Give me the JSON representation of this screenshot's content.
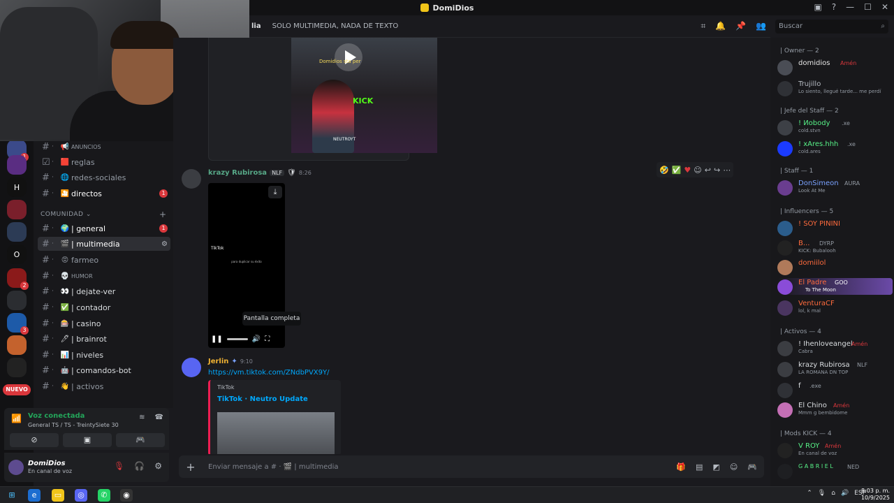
{
  "window": {
    "title": "DomiDios"
  },
  "header": {
    "channel_name": "lia",
    "topic": "SOLO MULTIMEDIA, NADA DE TEXTO",
    "search_placeholder": "Buscar"
  },
  "rail": {
    "badge_1": "1",
    "badge_2": "2",
    "badge_3": "3",
    "badge_4": "3",
    "letter_h": "H",
    "letter_o": "O",
    "new_label": "NUEVO"
  },
  "channels": {
    "category": "COMUNIDAD",
    "items": [
      {
        "emoji": "📢",
        "name": "ANUNCIOS",
        "badge": ""
      },
      {
        "emoji": "🟥",
        "name": "reglas",
        "badge": ""
      },
      {
        "emoji": "🌐",
        "name": "redes-sociales",
        "badge": ""
      },
      {
        "emoji": "🎦",
        "name": "directos",
        "badge": "1"
      },
      {
        "emoji": "🌍",
        "name": "| general",
        "badge": "1"
      },
      {
        "emoji": "🎬",
        "name": "| multimedia",
        "badge": ""
      },
      {
        "emoji": "😡",
        "name": "farmeo",
        "badge": ""
      },
      {
        "emoji": "💀",
        "name": "HUMOR",
        "badge": ""
      },
      {
        "emoji": "👀",
        "name": "| dejate-ver",
        "badge": ""
      },
      {
        "emoji": "✅",
        "name": "| contador",
        "badge": ""
      },
      {
        "emoji": "🎰",
        "name": "| casino",
        "badge": ""
      },
      {
        "emoji": "🖊",
        "name": "| brainrot",
        "badge": ""
      },
      {
        "emoji": "📊",
        "name": "| niveles",
        "badge": ""
      },
      {
        "emoji": "🤖",
        "name": "| comandos-bot",
        "badge": ""
      },
      {
        "emoji": "👋",
        "name": "| activos",
        "badge": ""
      }
    ]
  },
  "messages": {
    "thumb_caption": "Domidios sta per",
    "thumb_kick": "KICK",
    "thumb_tag": "NEUTROYT",
    "msg1": {
      "author": "krazy Rubirosa",
      "tag": "NLF",
      "time": "8:26"
    },
    "video": {
      "tiktok": "TikTok",
      "subtitle": "para duplicar su éxito",
      "tooltip": "Pantalla completa"
    },
    "msg2": {
      "author": "Jerlin",
      "time": "9:10",
      "link": "https://vm.tiktok.com/ZNdbPVX9Y/",
      "embed_provider": "TikTok",
      "embed_title": "TikTok · Neutro Update"
    }
  },
  "composer": {
    "placeholder": "Enviar mensaje a # · 🎬 | multimedia"
  },
  "members": {
    "groups": [
      {
        "label": "| Owner — 2"
      },
      {
        "label": "| Jefe del Staff — 2"
      },
      {
        "label": "| Staff — 1"
      },
      {
        "label": "| Influencers — 5"
      },
      {
        "label": "| Activos — 4"
      },
      {
        "label": "| Mods KICK — 4"
      }
    ],
    "list": [
      {
        "name": "domidios",
        "tag": "Amén",
        "status": "",
        "color": "#e6e6e6"
      },
      {
        "name": "Trujillo",
        "tag": "",
        "status": "Lo siento, llegué tarde... me perdí",
        "color": "#b5bac1"
      },
      {
        "name": "! Иobody",
        "tag": ".xe",
        "status": "cold.stvn",
        "color": "#57f287"
      },
      {
        "name": "! xAres.hhh",
        "tag": ".xe",
        "status": "cold.ares",
        "color": "#57f287"
      },
      {
        "name": "DonSimeon",
        "tag": "AURA",
        "status": "Look At Me",
        "color": "#7aa2ff"
      },
      {
        "name": "! SOY PININI",
        "tag": "",
        "status": "",
        "color": "#ff6b3d"
      },
      {
        "name": "B...",
        "tag": "DYRP",
        "status": "KICK: Bubalooh",
        "color": "#ff6b3d"
      },
      {
        "name": "domiilol",
        "tag": "",
        "status": "",
        "color": "#ff6b3d"
      },
      {
        "name": "El Padre",
        "tag": "GOO",
        "status": "To The Moon",
        "color": "#ff6b3d"
      },
      {
        "name": "VenturaCF",
        "tag": "",
        "status": "lol, k mal",
        "color": "#ff6b3d"
      },
      {
        "name": "! Ihenloveangel",
        "tag": "Amén",
        "status": "Cabra",
        "color": "#dbdee1"
      },
      {
        "name": "krazy Rubirosa",
        "tag": "NLF",
        "status": "LA ROMANA DN TOP",
        "color": "#dbdee1"
      },
      {
        "name": "f",
        "tag": ".exe",
        "status": "",
        "color": "#dbdee1"
      },
      {
        "name": "El Chino",
        "tag": "Amén",
        "status": "Mmm g bembidome",
        "color": "#dbdee1"
      },
      {
        "name": "V ROY",
        "tag": "Amén",
        "status": "En canal de voz",
        "color": "#57f287"
      },
      {
        "name": "G A B R I E L",
        "tag": "NED",
        "status": "",
        "color": "#57f287"
      }
    ]
  },
  "voice": {
    "title": "Voz conectada",
    "subtitle": "General TS / TS - TreintySiete 30"
  },
  "user": {
    "name": "DomiDios",
    "status": "En canal de voz"
  },
  "taskbar": {
    "lang": "ESP",
    "time": "8:03 p. m.",
    "date": "10/9/2025"
  }
}
